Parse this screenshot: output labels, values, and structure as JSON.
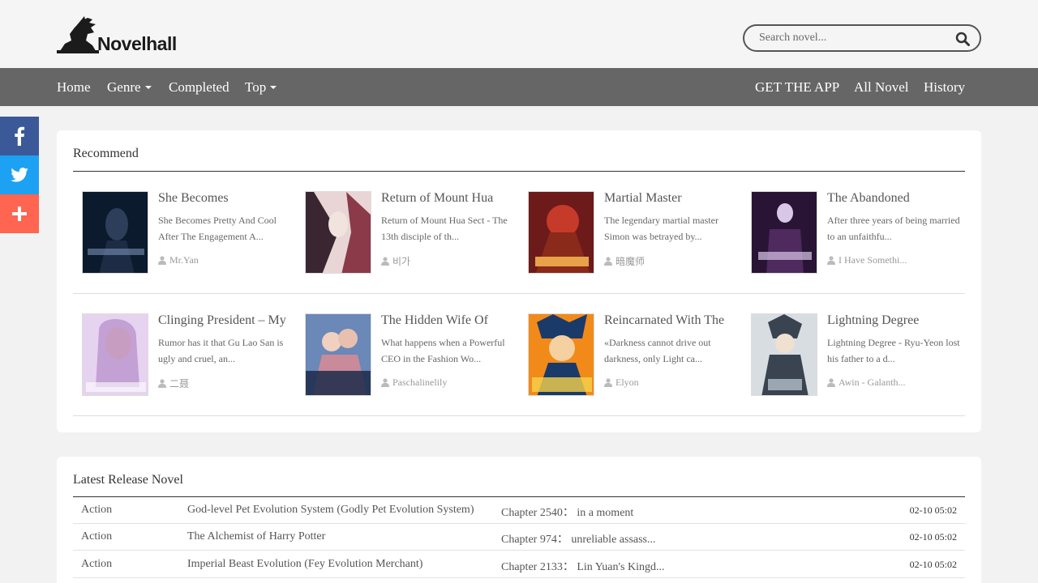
{
  "site": {
    "logo_text": "Novelhall"
  },
  "search": {
    "placeholder": "Search novel..."
  },
  "nav": {
    "left": [
      {
        "label": "Home",
        "dropdown": false
      },
      {
        "label": "Genre",
        "dropdown": true
      },
      {
        "label": "Completed",
        "dropdown": false
      },
      {
        "label": "Top",
        "dropdown": true
      }
    ],
    "right": [
      {
        "label": "GET THE APP"
      },
      {
        "label": "All Novel"
      },
      {
        "label": "History"
      }
    ]
  },
  "social": [
    {
      "name": "facebook-icon",
      "color": "#3b5998"
    },
    {
      "name": "twitter-icon",
      "color": "#1da1f2"
    },
    {
      "name": "share-plus-icon",
      "color": "#ff6550"
    }
  ],
  "recommend": {
    "title": "Recommend",
    "books": [
      {
        "title": "She Becomes",
        "desc": "She Becomes Pretty And Cool After The Engagement A...",
        "author": "Mr.Yan",
        "cover_colors": [
          "#0b1a2c",
          "#2d3e5a",
          "#7a8fb5"
        ]
      },
      {
        "title": "Return of Mount Hua",
        "desc": "Return of Mount Hua Sect - The 13th disciple of th...",
        "author": "비가",
        "cover_colors": [
          "#e9d5d5",
          "#8b3a4a",
          "#3a2630"
        ]
      },
      {
        "title": "Martial Master",
        "desc": "The legendary martial master Simon was betrayed by...",
        "author": "暗魔师",
        "cover_colors": [
          "#6d1a1a",
          "#c63a2a",
          "#e8a24a"
        ]
      },
      {
        "title": "The Abandoned",
        "desc": "After three years of being married to an unfaithfu...",
        "author": "I Have Somethi...",
        "cover_colors": [
          "#2a1436",
          "#4e2a5e",
          "#d9c7e8"
        ]
      },
      {
        "title": "Clinging President – My",
        "desc": "Rumor has it that Gu Lao San is ugly and cruel, an...",
        "author": "二聂",
        "cover_colors": [
          "#e6d3ef",
          "#b48cc9",
          "#f3c9b0"
        ]
      },
      {
        "title": "The Hidden Wife Of",
        "desc": "What happens when a Powerful CEO in the Fashion Wo...",
        "author": "Paschalinelily",
        "cover_colors": [
          "#6a88b8",
          "#c98a9a",
          "#1b2a4a"
        ]
      },
      {
        "title": "Reincarnated With The",
        "desc": "«Darkness cannot drive out darkness, only Light ca...",
        "author": "Elyon",
        "cover_colors": [
          "#f28a1a",
          "#1a3a6a",
          "#f5d24a"
        ]
      },
      {
        "title": "Lightning Degree",
        "desc": "Lightning Degree - Ryu-Yeon lost his father to a d...",
        "author": "Awin - Galanth...",
        "cover_colors": [
          "#d8dde2",
          "#3a4450",
          "#9aa6b2"
        ]
      }
    ]
  },
  "latest": {
    "title": "Latest Release Novel",
    "rows": [
      {
        "genre": "Action",
        "title": "God-level Pet Evolution System (Godly Pet Evolution System)",
        "chapter": "Chapter 2540： in a moment",
        "time": "02-10 05:02"
      },
      {
        "genre": "Action",
        "title": "The Alchemist of Harry Potter",
        "chapter": "Chapter 974： unreliable assass...",
        "time": "02-10 05:02"
      },
      {
        "genre": "Action",
        "title": "Imperial Beast Evolution (Fey Evolution Merchant)",
        "chapter": "Chapter 2133： Lin Yuan's Kingd...",
        "time": "02-10 05:02"
      }
    ]
  }
}
